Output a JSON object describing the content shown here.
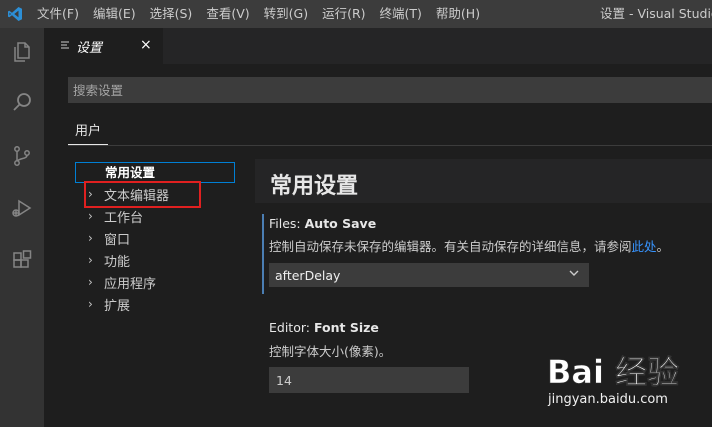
{
  "menu": [
    "文件(F)",
    "编辑(E)",
    "选择(S)",
    "查看(V)",
    "转到(G)",
    "运行(R)",
    "终端(T)",
    "帮助(H)"
  ],
  "window_title": "设置 - Visual Studio C",
  "activity_icons": [
    "files-icon",
    "search-icon",
    "source-control-icon",
    "run-debug-icon",
    "extensions-icon"
  ],
  "tab": {
    "label": "设置",
    "close": "×"
  },
  "search": {
    "placeholder": "搜索设置"
  },
  "scope_tab": "用户",
  "toc": {
    "selected": "常用设置",
    "items": [
      "文本编辑器",
      "工作台",
      "窗口",
      "功能",
      "应用程序",
      "扩展"
    ]
  },
  "section_title": "常用设置",
  "settings": {
    "auto_save": {
      "category": "Files: ",
      "name": "Auto Save",
      "description": "控制自动保存未保存的编辑器。有关自动保存的详细信息，请参阅",
      "link": "此处",
      "suffix": "。",
      "value": "afterDelay"
    },
    "font_size": {
      "category": "Editor: ",
      "name": "Font Size",
      "description": "控制字体大小(像素)。",
      "value": "14"
    }
  },
  "watermark": {
    "brand": "Bai 经验",
    "url": "jingyan.baidu.com"
  },
  "colors": {
    "accent": "#007fd4",
    "highlight": "#e02020",
    "link": "#3794ff"
  }
}
